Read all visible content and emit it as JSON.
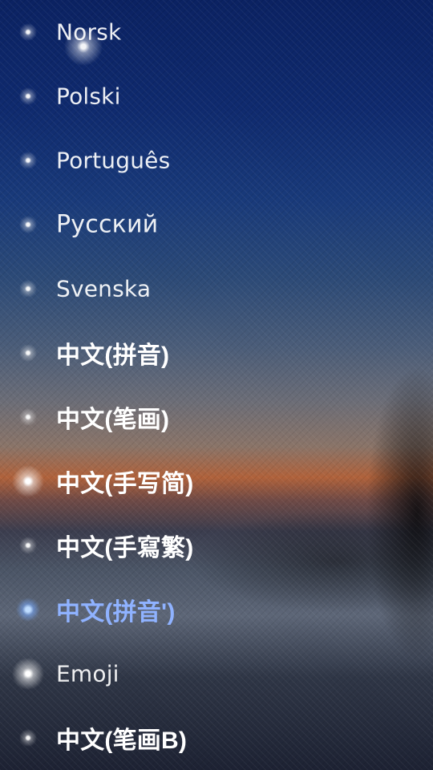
{
  "languages": [
    {
      "label": "Norsk"
    },
    {
      "label": "Polski"
    },
    {
      "label": "Português"
    },
    {
      "label": "Русский"
    },
    {
      "label": "Svenska"
    },
    {
      "label": "中文(拼音)"
    },
    {
      "label": "中文(笔画)"
    },
    {
      "label": "中文(手写简)"
    },
    {
      "label": "中文(手寫繁)"
    },
    {
      "label": "中文(拼音')"
    },
    {
      "label": "Emoji"
    },
    {
      "label": "中文(笔画B)"
    }
  ],
  "selected": "中文(拼音')",
  "colors": {
    "active_text": "#8fb2ff",
    "text": "#ffffff",
    "background_top": "#0b2262",
    "background_sunset": "#b0623b"
  },
  "icons": {
    "item_marker": "sparkle-dot-icon"
  }
}
